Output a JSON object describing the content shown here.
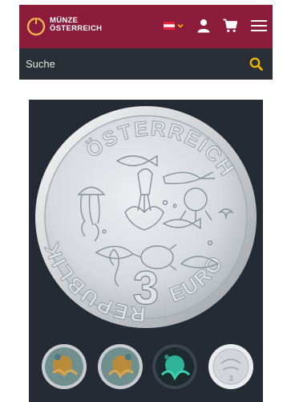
{
  "header": {
    "logo_line1": "MÜNZE",
    "logo_line2": "ÖSTERREICH",
    "brand_color": "#8c1c3c",
    "language_flag": "austria-flag-icon",
    "icons": [
      "user-icon",
      "cart-icon",
      "hamburger-menu-icon"
    ]
  },
  "search": {
    "placeholder": "Suche",
    "icon": "search-icon",
    "icon_color": "#f0b400"
  },
  "coin": {
    "inscription_top": "REPUBLIK ÖSTERREICH",
    "denomination_value": "3",
    "denomination_unit": "EURO"
  },
  "gallery": {
    "background": "#252b34",
    "thumbnails": [
      {
        "name": "octopus-coin-color-thumb"
      },
      {
        "name": "octopus-coin-color-thumb-2"
      },
      {
        "name": "octopus-coin-glow-thumb"
      },
      {
        "name": "coin-reverse-thumb"
      }
    ]
  }
}
